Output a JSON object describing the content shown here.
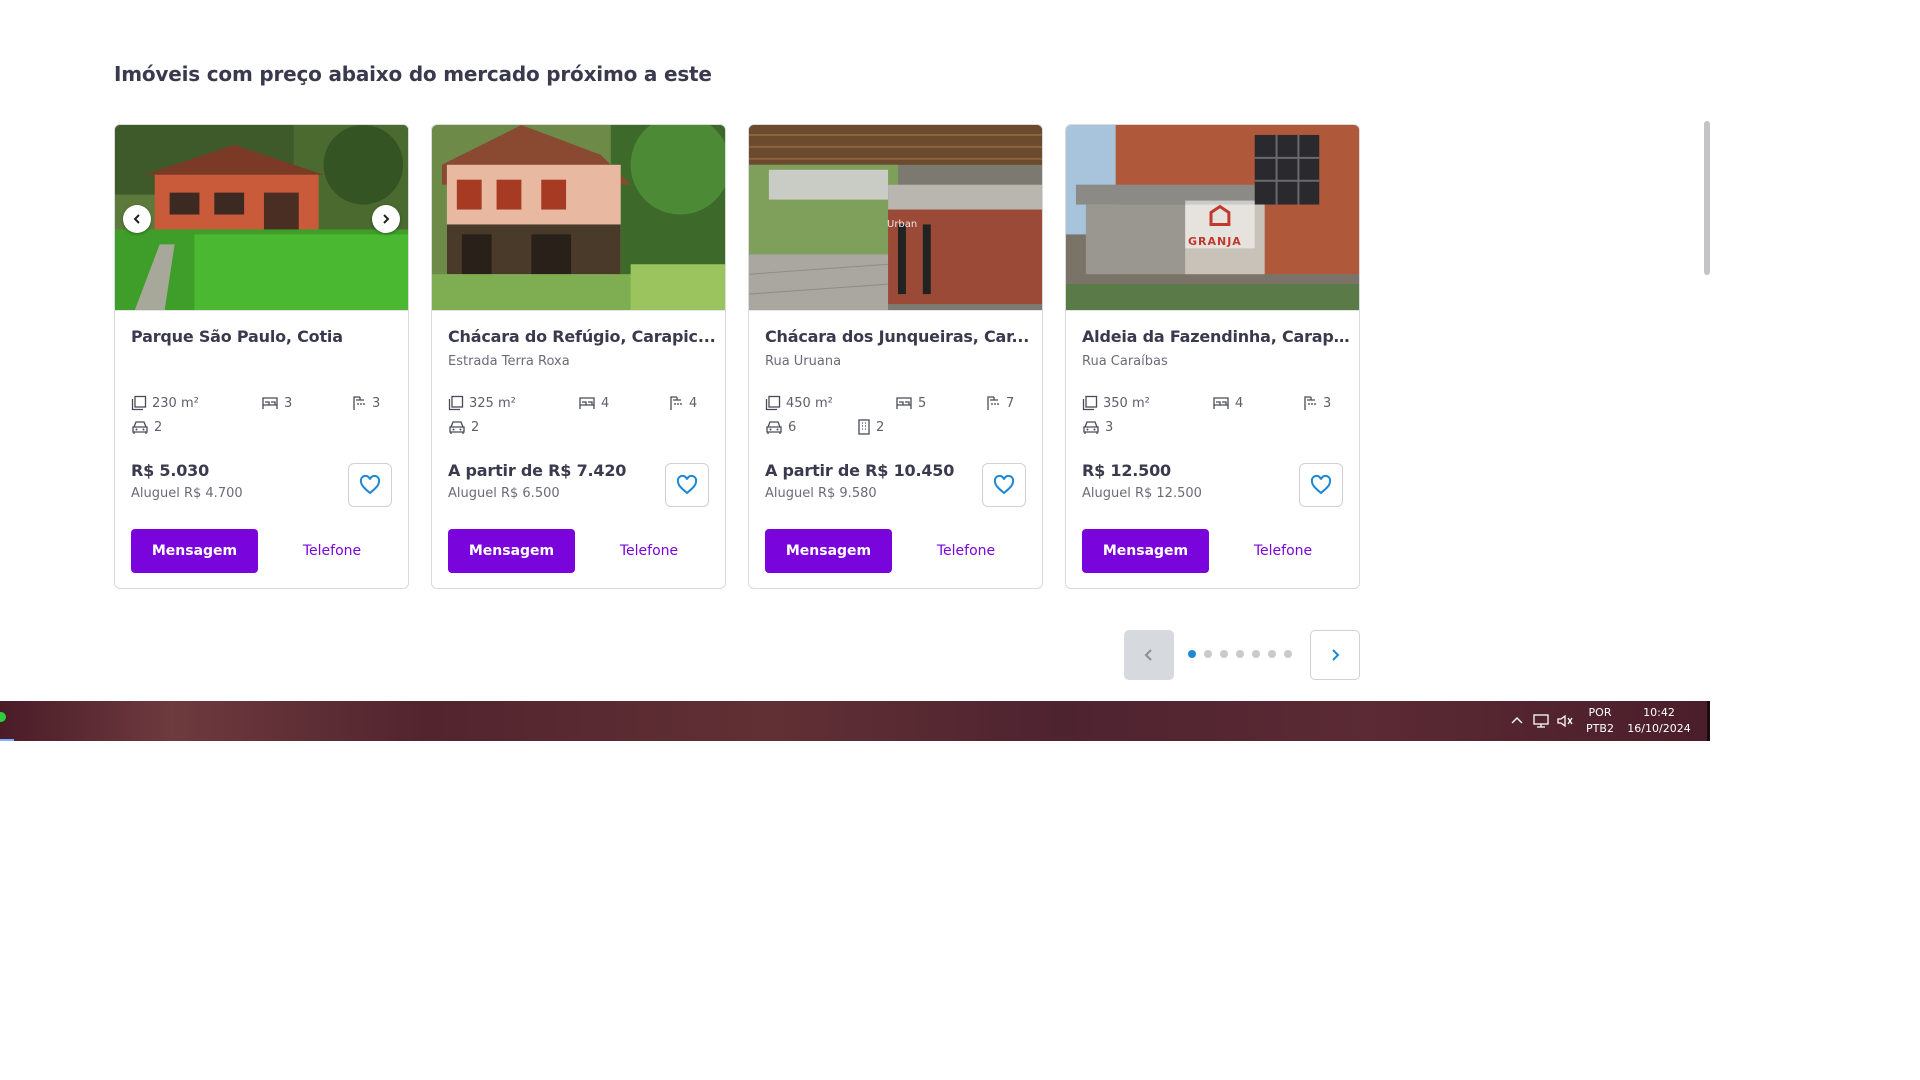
{
  "section": {
    "title": "Imóveis com preço abaixo do mercado próximo a este"
  },
  "cards": [
    {
      "title": "Parque São Paulo, Cotia",
      "street": "",
      "area": "230 m²",
      "bedrooms": "3",
      "bathrooms": "3",
      "parking": "2",
      "suites": "",
      "price": "R$ 5.030",
      "rent": "Aluguel R$ 4.700",
      "message_label": "Mensagem",
      "phone_label": "Telefone"
    },
    {
      "title": "Chácara do Refúgio, Carapic...",
      "street": "Estrada Terra Roxa",
      "area": "325 m²",
      "bedrooms": "4",
      "bathrooms": "4",
      "parking": "2",
      "suites": "",
      "price": "A partir de R$ 7.420",
      "rent": "Aluguel R$ 6.500",
      "message_label": "Mensagem",
      "phone_label": "Telefone"
    },
    {
      "title": "Chácara dos Junqueiras, Car...",
      "street": "Rua Uruana",
      "area": "450 m²",
      "bedrooms": "5",
      "bathrooms": "7",
      "parking": "6",
      "suites": "2",
      "price": "A partir de R$ 10.450",
      "rent": "Aluguel R$ 9.580",
      "message_label": "Mensagem",
      "phone_label": "Telefone",
      "watermark": "Urban"
    },
    {
      "title": "Aldeia da Fazendinha, Carapi...",
      "street": "Rua Caraíbas",
      "area": "350 m²",
      "bedrooms": "4",
      "bathrooms": "3",
      "parking": "3",
      "suites": "",
      "price": "R$ 12.500",
      "rent": "Aluguel R$ 12.500",
      "message_label": "Mensagem",
      "phone_label": "Telefone",
      "logo_text": "GRANJA"
    }
  ],
  "pager": {
    "total_pages": 7,
    "active_page": 1
  },
  "taskbar": {
    "lang_top": "POR",
    "lang_bottom": "PTB2",
    "time": "10:42",
    "date": "16/10/2024"
  },
  "colors": {
    "accent": "#7a04dc",
    "favorite": "#1e88d6",
    "dot_active": "#1e88d6"
  }
}
